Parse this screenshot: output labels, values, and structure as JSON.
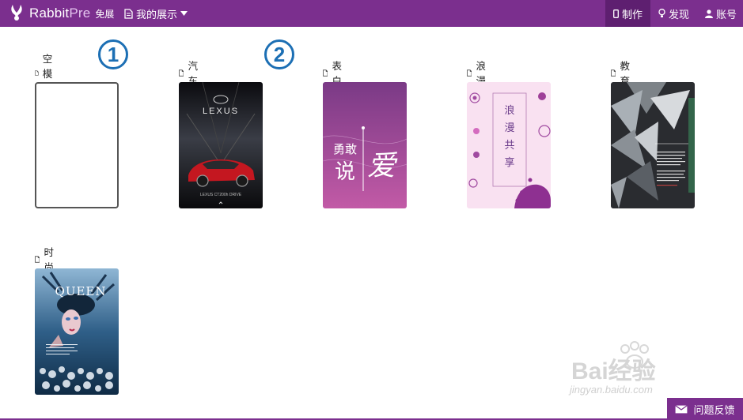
{
  "topbar": {
    "brand_main": "Rabbit",
    "brand_pre": "Pre",
    "brand_badge": "免展",
    "showcase_label": "我的展示",
    "nav": [
      {
        "label": "制作"
      },
      {
        "label": "发现"
      },
      {
        "label": "账号"
      }
    ]
  },
  "templates": [
    {
      "label": "空模板"
    },
    {
      "label": "汽车",
      "thumb_text_1": "LEXUS",
      "thumb_text_2": "LEXUS CT200h DRIVE"
    },
    {
      "label": "表白",
      "thumb_text_1": "勇敢",
      "thumb_text_2": "说",
      "thumb_text_3": "爱"
    },
    {
      "label": "浪漫",
      "thumb_text_1": "浪漫共享"
    },
    {
      "label": "教育"
    },
    {
      "label": "时尚",
      "thumb_text_1": "QUEEN"
    }
  ],
  "annotations": [
    "1",
    "2"
  ],
  "watermark": {
    "text": "Bai经验",
    "url": "jingyan.baidu.com"
  },
  "feedback": {
    "label": "问题反馈"
  },
  "colors": {
    "brand": "#7b2f8e",
    "brand_dark": "#5e1f70",
    "annotation": "#1c6fb4"
  }
}
